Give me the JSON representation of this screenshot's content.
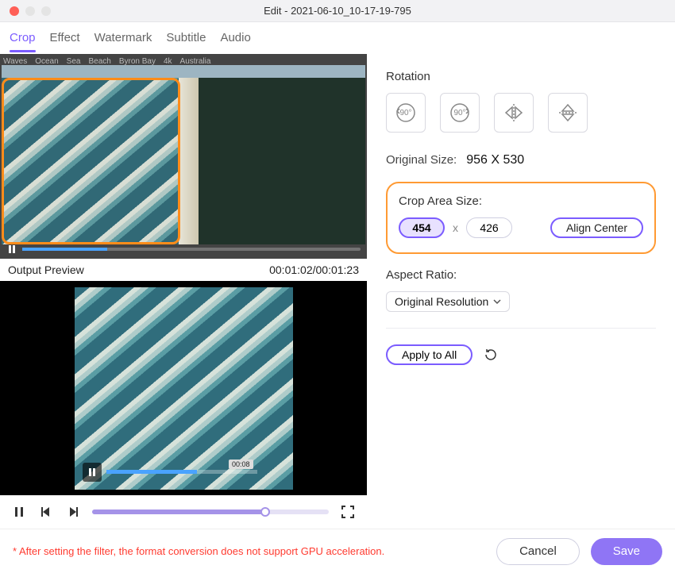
{
  "window": {
    "title": "Edit - 2021-06-10_10-17-19-795"
  },
  "tabs": {
    "items": [
      "Crop",
      "Effect",
      "Watermark",
      "Subtitle",
      "Audio"
    ],
    "active": 0
  },
  "preview": {
    "meta_tags": [
      "Waves",
      "Ocean",
      "Sea",
      "Beach",
      "Byron Bay",
      "4k",
      "Australia"
    ],
    "output_label": "Output Preview",
    "time_display": "00:01:02/00:01:23",
    "mini_time": "00:08"
  },
  "rotation": {
    "label": "Rotation",
    "btn_ccw": "90°",
    "btn_cw": "90°"
  },
  "original_size": {
    "label": "Original Size:",
    "value": "956 X 530"
  },
  "crop": {
    "label": "Crop Area Size:",
    "width": "454",
    "height": "426",
    "separator": "x",
    "align_center": "Align Center"
  },
  "aspect": {
    "label": "Aspect Ratio:",
    "selected": "Original Resolution"
  },
  "apply": {
    "apply_all": "Apply to All"
  },
  "footer": {
    "warning": "* After setting the filter, the format conversion does not support GPU acceleration.",
    "cancel": "Cancel",
    "save": "Save"
  }
}
